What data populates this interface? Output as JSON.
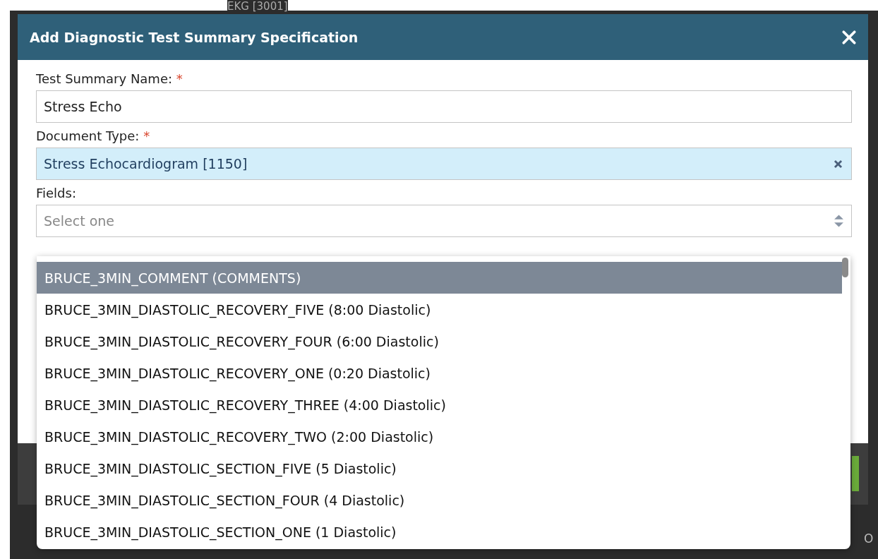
{
  "background": {
    "top_text": "EKG [3001]",
    "edge_text": "O"
  },
  "dialog": {
    "title": "Add Diagnostic Test Summary Specification",
    "fields": [
      {
        "kind": "text",
        "label": "Test Summary Name:",
        "required_mark": "*",
        "value": "Stress Echo"
      },
      {
        "kind": "tag",
        "label": "Document Type:",
        "required_mark": "*",
        "value": "Stress Echocardiogram [1150]"
      },
      {
        "kind": "select",
        "label": "Fields:",
        "placeholder": "Select one"
      }
    ],
    "options": [
      {
        "label": "BRUCE_3MIN_COMMENT (COMMENTS)",
        "selected": true
      },
      {
        "label": "BRUCE_3MIN_DIASTOLIC_RECOVERY_FIVE (8:00 Diastolic)",
        "selected": false
      },
      {
        "label": "BRUCE_3MIN_DIASTOLIC_RECOVERY_FOUR (6:00 Diastolic)",
        "selected": false
      },
      {
        "label": "BRUCE_3MIN_DIASTOLIC_RECOVERY_ONE (0:20 Diastolic)",
        "selected": false
      },
      {
        "label": "BRUCE_3MIN_DIASTOLIC_RECOVERY_THREE (4:00 Diastolic)",
        "selected": false
      },
      {
        "label": "BRUCE_3MIN_DIASTOLIC_RECOVERY_TWO (2:00 Diastolic)",
        "selected": false
      },
      {
        "label": "BRUCE_3MIN_DIASTOLIC_SECTION_FIVE (5 Diastolic)",
        "selected": false
      },
      {
        "label": "BRUCE_3MIN_DIASTOLIC_SECTION_FOUR (4 Diastolic)",
        "selected": false
      },
      {
        "label": "BRUCE_3MIN_DIASTOLIC_SECTION_ONE (1 Diastolic)",
        "selected": false
      }
    ]
  }
}
